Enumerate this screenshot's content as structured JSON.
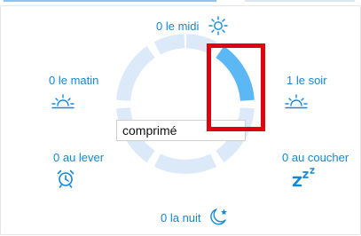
{
  "theme": {
    "accent": "#1488d8",
    "ring_track": "#dbe9f9",
    "ring_active": "#5cb8f5",
    "highlight": "#e0000e"
  },
  "wheel": {
    "segments": [
      {
        "key": "midi",
        "label": "0 le midi",
        "icon": "sun-icon",
        "active": false
      },
      {
        "key": "soir",
        "label": "1 le soir",
        "icon": "sunset-icon",
        "active": true
      },
      {
        "key": "coucher",
        "label": "0 au coucher",
        "icon": "sleep-zzz-icon",
        "active": false
      },
      {
        "key": "nuit",
        "label": "0 la nuit",
        "icon": "moon-star-icon",
        "active": false
      },
      {
        "key": "lever",
        "label": "0 au lever",
        "icon": "alarm-clock-icon",
        "active": false
      },
      {
        "key": "matin",
        "label": "0 le matin",
        "icon": "sunrise-icon",
        "active": false
      }
    ]
  },
  "dose_input": {
    "value": "comprimé"
  }
}
